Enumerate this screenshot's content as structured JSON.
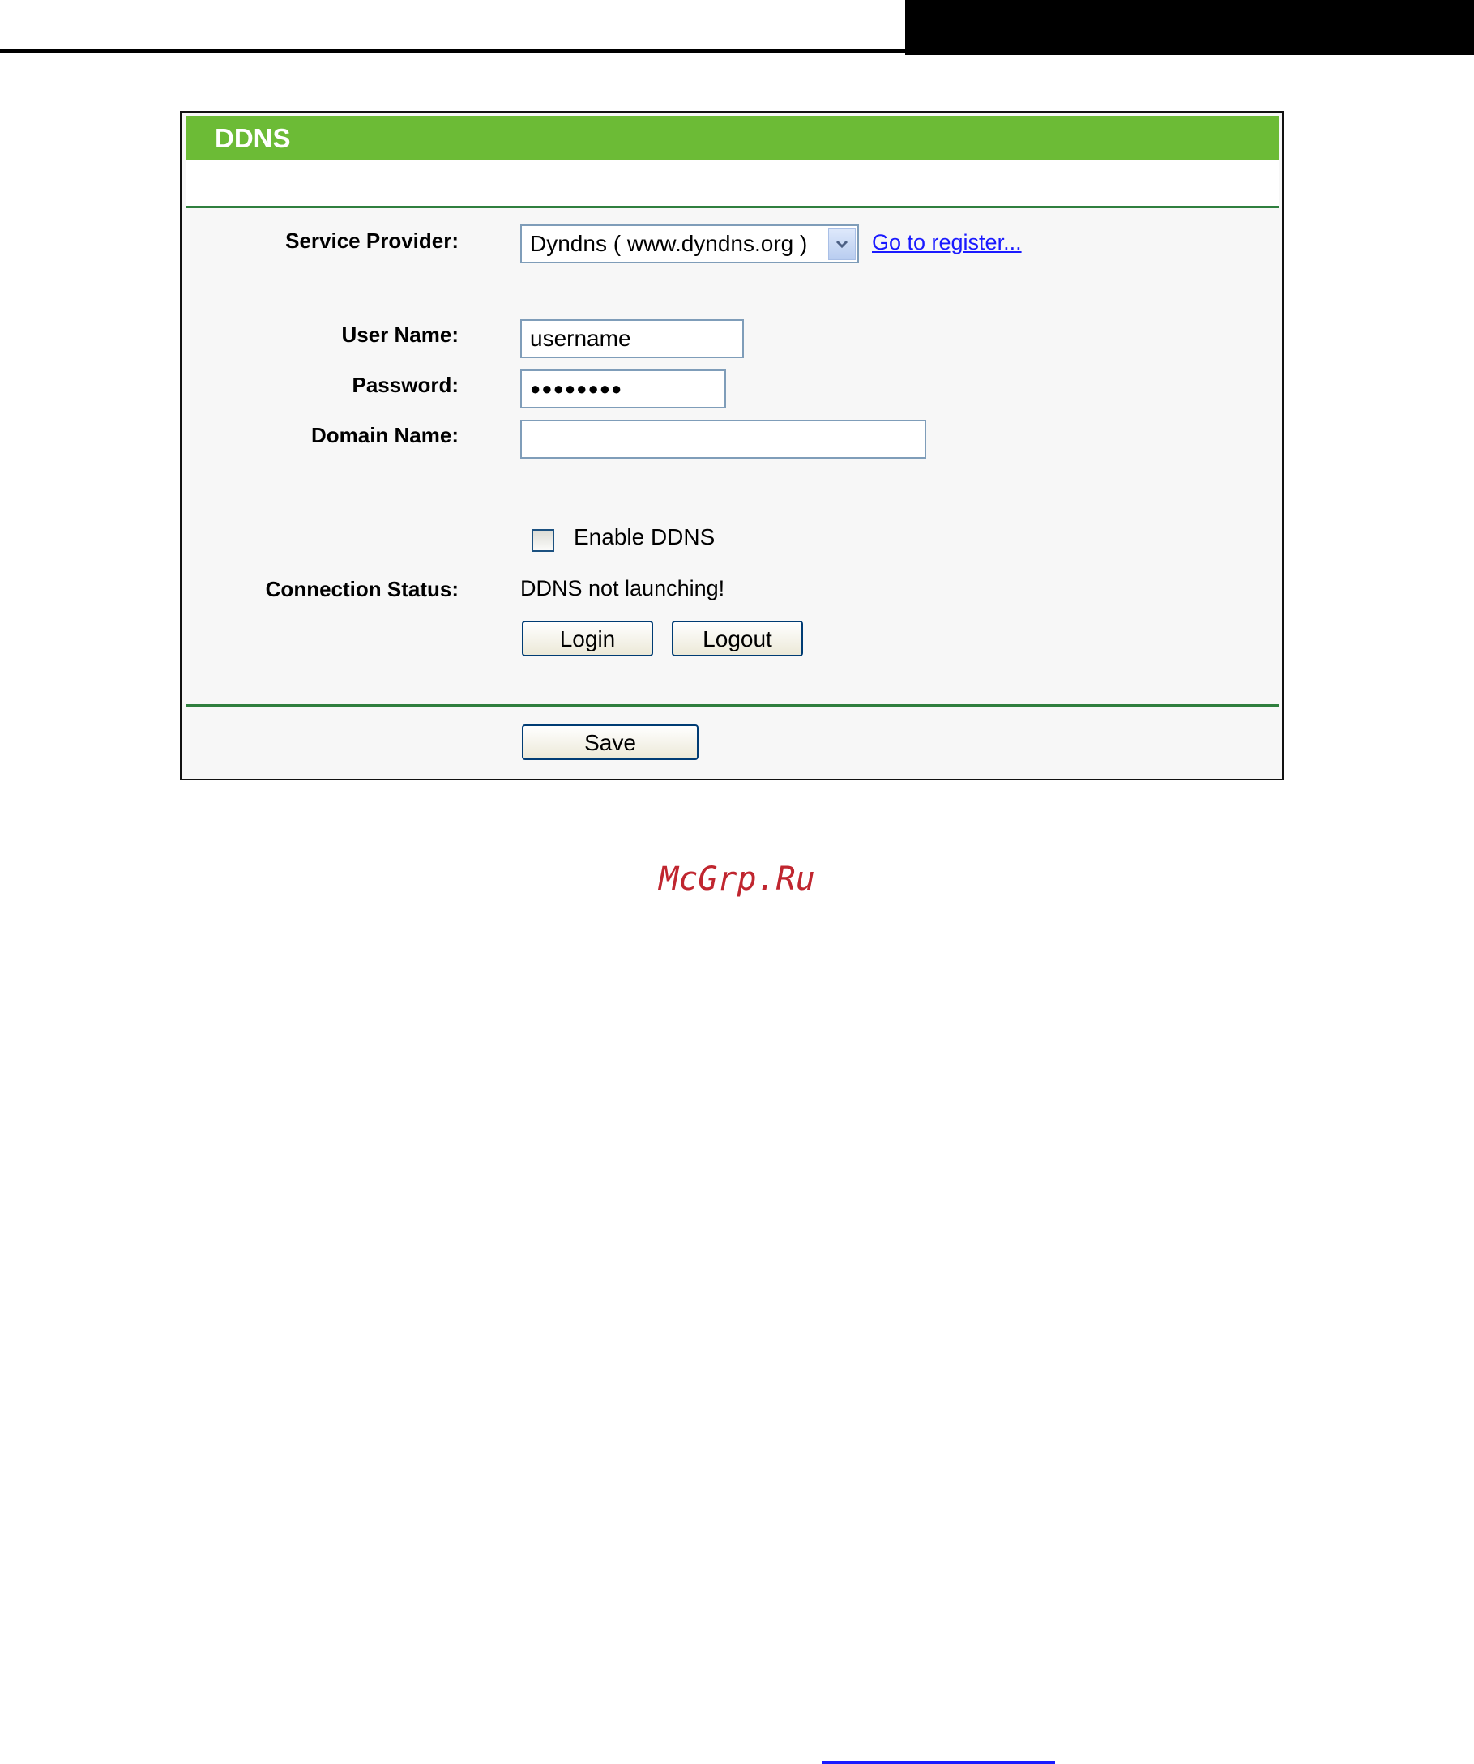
{
  "panel": {
    "title": "DDNS"
  },
  "form": {
    "service_provider_label": "Service Provider:",
    "service_provider_value": "Dyndns ( www.dyndns.org )",
    "register_link": "Go to register...",
    "user_name_label": "User Name:",
    "user_name_value": "username",
    "password_label": "Password:",
    "password_value": "●●●●●●●●",
    "domain_name_label": "Domain Name:",
    "domain_name_value": "",
    "enable_ddns_label": "Enable DDNS",
    "enable_ddns_checked": false,
    "connection_status_label": "Connection Status:",
    "connection_status_value": "DDNS not launching!",
    "login_button": "Login",
    "logout_button": "Logout",
    "save_button": "Save"
  },
  "watermark": "McGrp.Ru",
  "colors": {
    "title_bar": "#6cbb36",
    "rule": "#2f7f3e",
    "link": "#1a1aff",
    "watermark": "#c0262f"
  }
}
